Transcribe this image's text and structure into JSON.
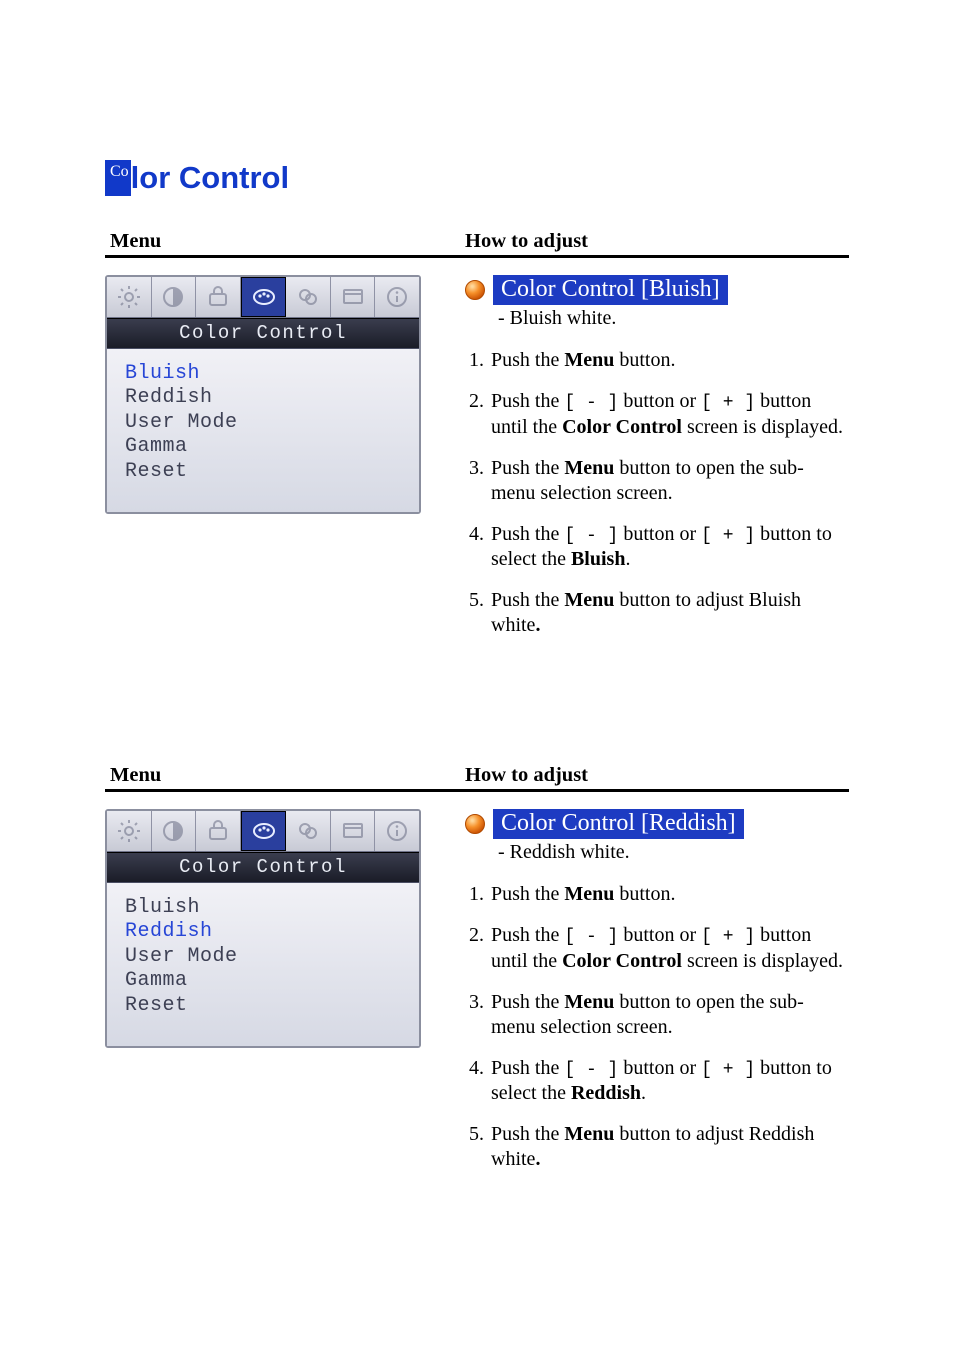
{
  "page_title_first": "Co",
  "page_title_rest": "lor Control",
  "headers": {
    "menu": "Menu",
    "adjust": "How to adjust"
  },
  "osd": {
    "title": "Color Control",
    "items": [
      "Bluish",
      "Reddish",
      "User Mode",
      "Gamma",
      "Reset"
    ]
  },
  "sections": [
    {
      "highlight_index": 0,
      "subheader": "Color Control [Bluish]",
      "sub_desc": "-  Bluish white.",
      "selected_name": "Bluish",
      "adjust_target": "Bluish white"
    },
    {
      "highlight_index": 1,
      "subheader": "Color Control [Reddish]",
      "sub_desc": "-  Reddish white.",
      "selected_name": "Reddish",
      "adjust_target": "Reddish white"
    }
  ],
  "strings": {
    "push_the": "Push the ",
    "menu_btn": "Menu",
    "button_period": " button.",
    "button_or": " button or ",
    "button_until": " button until the ",
    "color_control": "Color Control",
    "screen_disp": " screen is displayed.",
    "open_sub": " button to open the sub-menu selection screen.",
    "button_to_select": " button to select the ",
    "button_to_adjust": " button to adjust ",
    "minus": "[ - ]",
    "plus": "[ + ]",
    "period": "."
  }
}
